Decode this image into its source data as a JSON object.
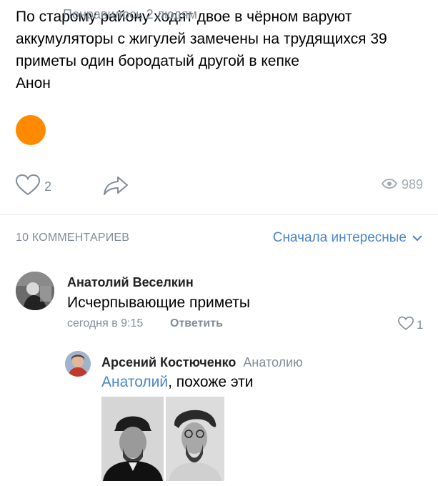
{
  "post": {
    "lines": [
      "По старому району ходят двое в чёрном варуют",
      "аккумуляторы с жигулей замечены на трудящихся 39",
      "приметы один бородатый другой в кепке",
      "Анон"
    ],
    "likes_text": "Понравилось 2 людям",
    "like_count": "2",
    "views": "989"
  },
  "comments_header": {
    "count_label": "10 КОММЕНТАРИЕВ",
    "sort_label": "Сначала интересные"
  },
  "comments": [
    {
      "author": "Анатолий Веселкин",
      "text": "Исчерпывающие приметы",
      "time": "сегодня в 9:15",
      "reply_label": "Ответить",
      "likes": "1"
    },
    {
      "author": "Арсений Костюченко",
      "reply_to": "Анатолию",
      "mention": "Анатолий",
      "text_rest": ", похоже эти"
    }
  ],
  "colors": {
    "accent": "#4a86c8",
    "secondary_text": "#818c99",
    "liker_avatar": "#ff8a00"
  }
}
